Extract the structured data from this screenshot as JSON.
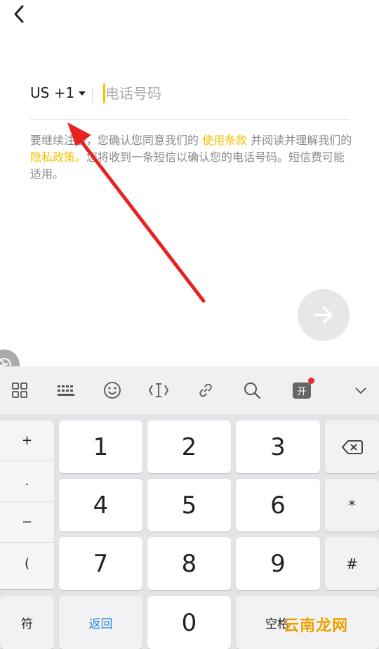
{
  "header": {
    "back_icon": "chevron-left-icon"
  },
  "phone": {
    "country_code": "US +1",
    "placeholder": "电话号码",
    "value": ""
  },
  "terms": {
    "part1": "要继续注册，您确认您同意我们的 ",
    "terms_link": "使用条款",
    "part2": " 并阅读并理解我们的 ",
    "privacy_link": "隐私政策。",
    "part3": "您将收到一条短信以确认您的电话号码。短信费可能适用。"
  },
  "next_button": {
    "icon": "arrow-right-icon"
  },
  "keyboard": {
    "toolbar_icons": [
      "grid-icon",
      "keyboard-icon",
      "emoji-icon",
      "text-cursor-icon",
      "link-icon",
      "search-icon",
      "app-icon",
      "chevron-down-icon"
    ],
    "symbols": [
      "+",
      ".",
      "−",
      "("
    ],
    "digits": [
      "1",
      "2",
      "3",
      "4",
      "5",
      "6",
      "7",
      "8",
      "9",
      "0"
    ],
    "backspace_icon": "backspace-icon",
    "star": "*",
    "hash": "#",
    "sym_key": "符",
    "back_key": "返回",
    "space_key": "空格"
  },
  "watermark": "云南龙网",
  "colors": {
    "accent_yellow": "#f0c000",
    "annotation_red": "#e8231f",
    "link_blue": "#2a87e0"
  }
}
